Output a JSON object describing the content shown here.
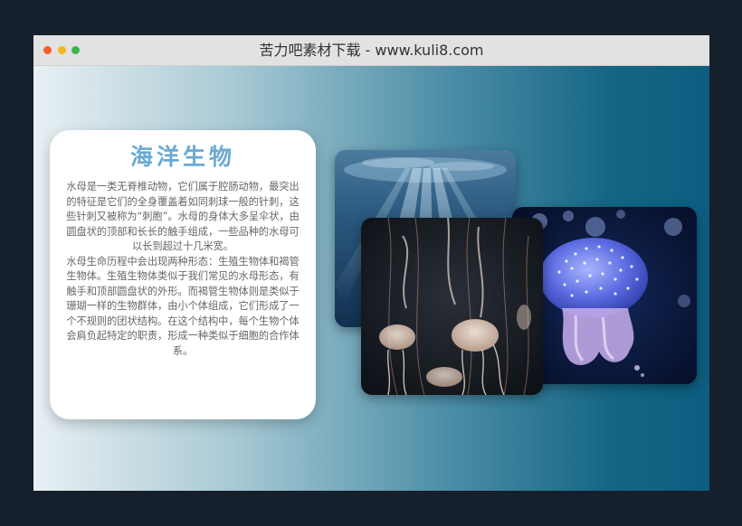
{
  "window": {
    "title": "苦力吧素材下载 - www.kuli8.com"
  },
  "article": {
    "title": "海洋生物",
    "paragraphs": [
      "水母是一类无脊椎动物，它们属于腔肠动物，最突出的特征是它们的全身覆盖着如同刺球一般的针刺，这些针刺又被称为“刺胞”。水母的身体大多呈伞状，由圆盘状的顶部和长长的触手组成，一些品种的水母可以长到超过十几米宽。",
      "水母生命历程中会出现两种形态：生殖生物体和褐管生物体。生殖生物体类似于我们常见的水母形态，有触手和顶部圆盘状的外形。而褐管生物体则是类似于珊瑚一样的生物群体，由小个体组成，它们形成了一个不规则的团状结构。在这个结构中，每个生物个体会肩负起特定的职责，形成一种类似于细胞的合作体系。"
    ]
  },
  "colors": {
    "title_accent": "#6aa9d3",
    "dot_red": "#f35f2a",
    "dot_yellow": "#f2b820",
    "dot_green": "#3bb54a"
  },
  "icons": {
    "window_close": "close-dot-icon",
    "window_minimize": "minimize-dot-icon",
    "window_maximize": "maximize-dot-icon"
  }
}
